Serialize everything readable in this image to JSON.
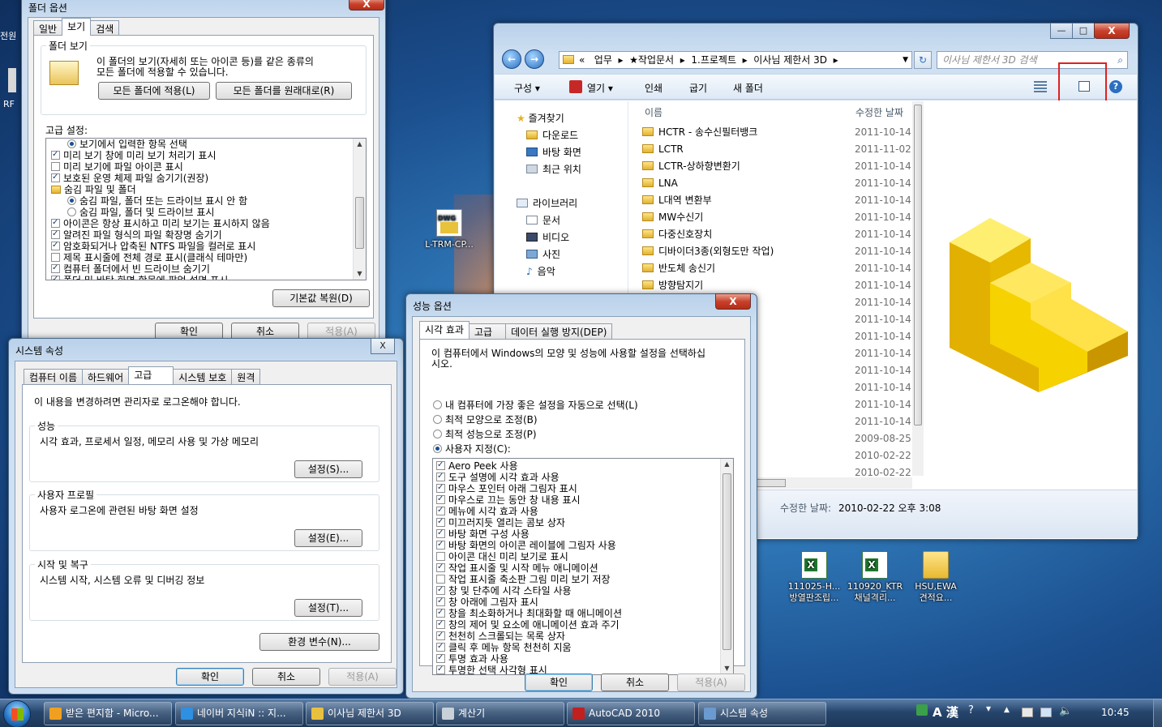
{
  "desktop": {
    "left_labels": [
      "전원",
      "RF"
    ],
    "icons": [
      {
        "label": "L-TRM-CP...",
        "type": "dwg"
      },
      {
        "label_line1": "111025-H...",
        "label_line2": "방열판조립...",
        "type": "xls"
      },
      {
        "label_line1": "110920_KTR",
        "label_line2": "채널격리...",
        "type": "xls"
      },
      {
        "label_line1": "HSU,EWA",
        "label_line2": "견적요...",
        "type": "folder"
      }
    ]
  },
  "folder_options": {
    "title": "폴더 옵션",
    "close": "X",
    "tabs": [
      "일반",
      "보기",
      "검색"
    ],
    "group_title": "폴더 보기",
    "desc_line1": "이 폴더의 보기(자세히 또는 아이콘 등)를 같은 종류의",
    "desc_line2": "모든 폴더에 적용할 수 있습니다.",
    "apply_all": "모든 폴더에 적용(L)",
    "reset_all": "모든 폴더를 원래대로(R)",
    "advanced_label": "고급 설정:",
    "items": [
      {
        "type": "radio",
        "checked": true,
        "indent": 1,
        "label": "보기에서 입력한 항목 선택"
      },
      {
        "type": "check",
        "checked": true,
        "indent": 0,
        "label": "미리 보기 창에 미리 보기 처리기 표시"
      },
      {
        "type": "check",
        "checked": false,
        "indent": 0,
        "label": "미리 보기에 파일 아이콘 표시"
      },
      {
        "type": "check",
        "checked": true,
        "indent": 0,
        "label": "보호된 운영 체제 파일 숨기기(권장)"
      },
      {
        "type": "folder",
        "checked": false,
        "indent": 0,
        "label": "숨김 파일 및 폴더"
      },
      {
        "type": "radio",
        "checked": true,
        "indent": 1,
        "label": "숨김 파일, 폴더 또는 드라이브 표시 안 함"
      },
      {
        "type": "radio",
        "checked": false,
        "indent": 1,
        "label": "숨김 파일, 폴더 및 드라이브 표시"
      },
      {
        "type": "check",
        "checked": true,
        "indent": 0,
        "label": "아이콘은 항상 표시하고 미리 보기는 표시하지 않음"
      },
      {
        "type": "check",
        "checked": true,
        "indent": 0,
        "label": "알려진 파일 형식의 파일 확장명 숨기기"
      },
      {
        "type": "check",
        "checked": true,
        "indent": 0,
        "label": "암호화되거나 압축된 NTFS 파일을 컬러로 표시"
      },
      {
        "type": "check",
        "checked": false,
        "indent": 0,
        "label": "제목 표시줄에 전체 경로 표시(클래식 테마만)"
      },
      {
        "type": "check",
        "checked": true,
        "indent": 0,
        "label": "컴퓨터 폴더에서 빈 드라이브 숨기기"
      },
      {
        "type": "check",
        "checked": true,
        "indent": 0,
        "label": "폴더 및 바탕 화면 항목에 팝업 설명 표시"
      }
    ],
    "restore": "기본값 복원(D)",
    "ok": "확인",
    "cancel": "취소",
    "apply": "적용(A)"
  },
  "system_props": {
    "title": "시스템 속성",
    "close": "X",
    "tabs": [
      "컴퓨터 이름",
      "하드웨어",
      "고급",
      "시스템 보호",
      "원격"
    ],
    "admin_note": "이 내용을 변경하려면 관리자로 로그온해야 합니다.",
    "perf_title": "성능",
    "perf_desc": "시각 효과, 프로세서 일정, 메모리 사용 및 가상 메모리",
    "perf_btn": "설정(S)...",
    "profile_title": "사용자 프로필",
    "profile_desc": "사용자 로그온에 관련된 바탕 화면 설정",
    "profile_btn": "설정(E)...",
    "startup_title": "시작 및 복구",
    "startup_desc": "시스템 시작, 시스템 오류 및 디버깅 정보",
    "startup_btn": "설정(T)...",
    "env_btn": "환경 변수(N)...",
    "ok": "확인",
    "cancel": "취소",
    "apply": "적용(A)"
  },
  "perf_options": {
    "title": "성능 옵션",
    "close": "X",
    "tabs": [
      "시각 효과",
      "고급",
      "데이터 실행 방지(DEP)"
    ],
    "desc_line1": "이 컴퓨터에서 Windows의 모양 및 성능에 사용할 설정을 선택하십",
    "desc_line2": "시오.",
    "radios": [
      {
        "label": "내 컴퓨터에 가장 좋은 설정을 자동으로 선택(L)",
        "checked": false
      },
      {
        "label": "최적 모양으로 조정(B)",
        "checked": false
      },
      {
        "label": "최적 성능으로 조정(P)",
        "checked": false
      },
      {
        "label": "사용자 지정(C):",
        "checked": true
      }
    ],
    "effects": [
      {
        "label": "Aero Peek 사용",
        "checked": true
      },
      {
        "label": "도구 설명에 시각 효과 사용",
        "checked": true
      },
      {
        "label": "마우스 포인터 아래 그림자 표시",
        "checked": true
      },
      {
        "label": "마우스로 끄는 동안 창 내용 표시",
        "checked": true
      },
      {
        "label": "메뉴에 시각 효과 사용",
        "checked": true
      },
      {
        "label": "미끄러지듯 열리는 콤보 상자",
        "checked": true
      },
      {
        "label": "바탕 화면 구성 사용",
        "checked": true
      },
      {
        "label": "바탕 화면의 아이콘 레이블에 그림자 사용",
        "checked": true
      },
      {
        "label": "아이콘 대신 미리 보기로 표시",
        "checked": false
      },
      {
        "label": "작업 표시줄 및 시작 메뉴 애니메이션",
        "checked": true
      },
      {
        "label": "작업 표시줄 축소판 그림 미리 보기 저장",
        "checked": false
      },
      {
        "label": "창 및 단추에 시각 스타일 사용",
        "checked": true
      },
      {
        "label": "창 아래에 그림자 표시",
        "checked": true
      },
      {
        "label": "창을 최소화하거나 최대화할 때 애니메이션",
        "checked": true
      },
      {
        "label": "창의 제어 및 요소에 애니메이션 효과 주기",
        "checked": true
      },
      {
        "label": "천천히 스크롤되는 목록 상자",
        "checked": true
      },
      {
        "label": "클릭 후 메뉴 항목 천천히 지움",
        "checked": true
      },
      {
        "label": "투명 효과 사용",
        "checked": true
      },
      {
        "label": "투명한 선택 사각형 표시",
        "checked": true
      }
    ],
    "ok": "확인",
    "cancel": "취소",
    "apply": "적용(A)"
  },
  "explorer": {
    "min": "—",
    "max": "□",
    "close": "X",
    "breadcrumb": [
      "«",
      "업무",
      "★작업문서",
      "1.프로젝트",
      "이사님 제한서 3D"
    ],
    "search_placeholder": "이사님 제한서 3D 검색",
    "toolbar": {
      "organize": "구성",
      "open": "열기",
      "print": "인쇄",
      "burn": "굽기",
      "new_folder": "새 폴더"
    },
    "nav": {
      "favorites": "즐겨찾기",
      "fav_items": [
        "다운로드",
        "바탕 화면",
        "최근 위치"
      ],
      "libraries": "라이브러리",
      "lib_items": [
        "문서",
        "비디오",
        "사진",
        "음악"
      ]
    },
    "col_name": "이름",
    "col_date": "수정한 날짜",
    "files": [
      {
        "name": "HCTR - 송수신필터뱅크",
        "date": "2011-10-14"
      },
      {
        "name": "LCTR",
        "date": "2011-11-02"
      },
      {
        "name": "LCTR-상하향변환기",
        "date": "2011-10-14"
      },
      {
        "name": "LNA",
        "date": "2011-10-14"
      },
      {
        "name": "L대역 변환부",
        "date": "2011-10-14"
      },
      {
        "name": "MW수신기",
        "date": "2011-10-14"
      },
      {
        "name": "다중신호장치",
        "date": "2011-10-14"
      },
      {
        "name": "디바이더3종(외형도만 작업)",
        "date": "2011-10-14"
      },
      {
        "name": "반도체 송신기",
        "date": "2011-10-14"
      },
      {
        "name": "방향탐지기",
        "date": "2011-10-14"
      },
      {
        "name": "",
        "date": "2011-10-14"
      },
      {
        "name": "",
        "date": "2011-10-14"
      },
      {
        "name": "",
        "date": "2011-10-14"
      },
      {
        "name": "",
        "date": "2011-10-14"
      },
      {
        "name": "",
        "date": "2011-10-14"
      },
      {
        "name": "",
        "date": "2011-10-14"
      },
      {
        "name": "",
        "date": "2011-10-14"
      },
      {
        "name": "",
        "date": "2011-10-14"
      },
      {
        "name": "",
        "date": "2009-08-25"
      },
      {
        "name": "",
        "date": "2010-02-22"
      },
      {
        "name": "",
        "date": "2010-02-22"
      }
    ],
    "details_label": "수정한 날짜:",
    "details_value": "2010-02-22 오후 3:08",
    "highlight_color": "#e02020"
  },
  "taskbar": {
    "buttons": [
      {
        "label": "받은 편지함 - Micro...",
        "color": "#f0a020"
      },
      {
        "label": "네이버 지식iN :: 지...",
        "color": "#2f8fe0"
      },
      {
        "label": "이사님 제한서 3D",
        "color": "#e8c040"
      },
      {
        "label": "계산기",
        "color": "#c8d0d8"
      },
      {
        "label": "AutoCAD 2010",
        "color": "#c02020"
      },
      {
        "label": "시스템 속성",
        "color": "#6a9ad0"
      }
    ],
    "ime": "A 漢",
    "clock": "10:45"
  }
}
